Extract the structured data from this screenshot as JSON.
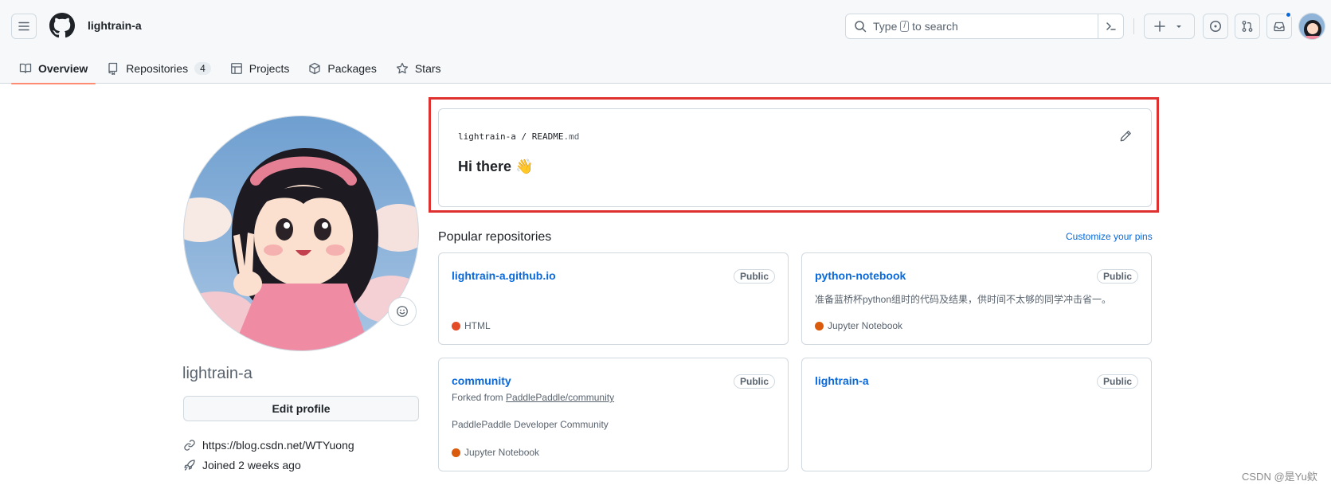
{
  "header": {
    "owner": "lightrain-a",
    "search_prefix": "Type",
    "search_key": "/",
    "search_suffix": "to search"
  },
  "tabs": [
    {
      "label": "Overview",
      "active": true
    },
    {
      "label": "Repositories",
      "count": "4"
    },
    {
      "label": "Projects"
    },
    {
      "label": "Packages"
    },
    {
      "label": "Stars"
    }
  ],
  "profile": {
    "username": "lightrain-a",
    "edit_label": "Edit profile",
    "website": "https://blog.csdn.net/WTYuong",
    "joined": "Joined 2 weeks ago"
  },
  "readme": {
    "owner": "lightrain-a",
    "sep": "/",
    "file_base": "README",
    "file_ext": ".md",
    "heading": "Hi there 👋"
  },
  "popular": {
    "title": "Popular repositories",
    "customize": "Customize your pins",
    "repos": [
      {
        "name": "lightrain-a.github.io",
        "badge": "Public",
        "language": "HTML",
        "lang_color": "#e34c26"
      },
      {
        "name": "python-notebook",
        "badge": "Public",
        "description": "准备蓝桥杯python组时的代码及结果，供时间不太够的同学冲击省一。",
        "language": "Jupyter Notebook",
        "lang_color": "#da5b0b"
      },
      {
        "name": "community",
        "badge": "Public",
        "forked_prefix": "Forked from",
        "forked_from": "PaddlePaddle/community",
        "description": "PaddlePaddle Developer Community",
        "language": "Jupyter Notebook",
        "lang_color": "#da5b0b"
      },
      {
        "name": "lightrain-a",
        "badge": "Public"
      }
    ]
  },
  "watermark": "CSDN @是Yu欸"
}
